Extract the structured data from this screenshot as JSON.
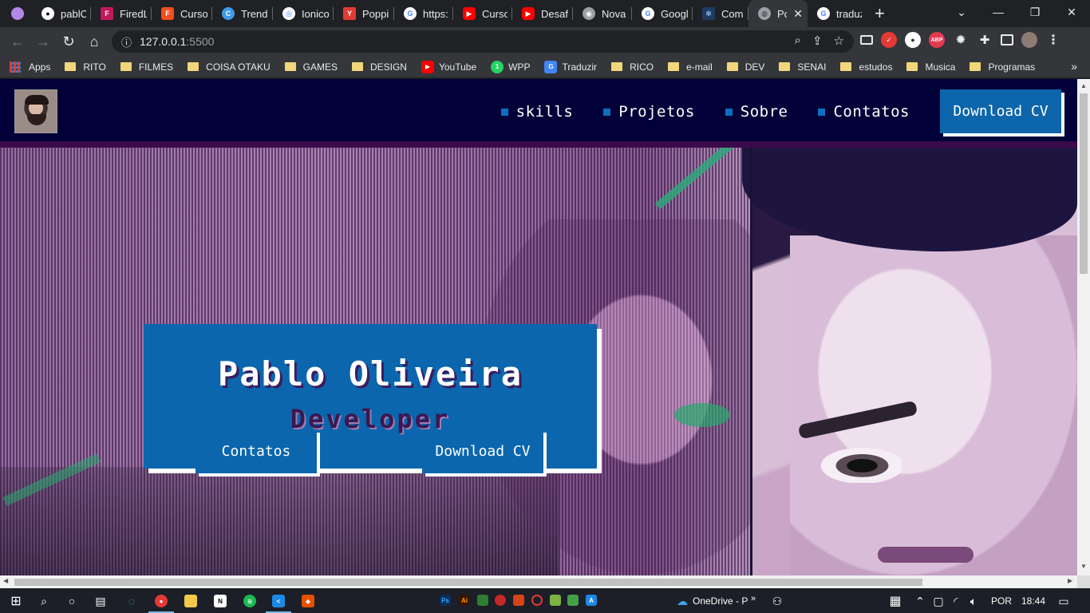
{
  "browser": {
    "tabs": [
      {
        "title": "",
        "icon": "purple-dot-icon",
        "color": "#b388e8"
      },
      {
        "title": "pablOl",
        "icon": "github-icon",
        "color": "#ffffff"
      },
      {
        "title": "FiredLa",
        "icon": "firedlab-icon",
        "color": "#c2185b"
      },
      {
        "title": "Curso_",
        "icon": "figma-icon",
        "color": "#f24e1e"
      },
      {
        "title": "Trendi",
        "icon": "trending-icon",
        "color": "#3d9be9"
      },
      {
        "title": "Ionicor",
        "icon": "ionicons-icon",
        "color": "#3880ff"
      },
      {
        "title": "Poppin",
        "icon": "poppins-icon",
        "color": "#e53935"
      },
      {
        "title": "https:/",
        "icon": "google-icon",
        "color": "#4285f4"
      },
      {
        "title": "Curso",
        "icon": "youtube-icon",
        "color": "#ff0000"
      },
      {
        "title": "Desafi",
        "icon": "youtube-icon",
        "color": "#ff0000"
      },
      {
        "title": "Nova g",
        "icon": "chrome-icon",
        "color": "#9aa0a6"
      },
      {
        "title": "Googl",
        "icon": "google-icon",
        "color": "#4285f4"
      },
      {
        "title": "Como",
        "icon": "snowflake-icon",
        "color": "#9fd3ff"
      },
      {
        "title": "Poi",
        "icon": "globe-icon",
        "color": "#9aa0a6"
      },
      {
        "title": "traduz",
        "icon": "google-icon",
        "color": "#4285f4"
      }
    ],
    "new_tab": "+",
    "url_host": "127.0.0.1",
    "url_port": ":5500",
    "bookmarks": [
      {
        "label": "Apps",
        "type": "apps"
      },
      {
        "label": "RITO",
        "type": "folder"
      },
      {
        "label": "FILMES",
        "type": "folder"
      },
      {
        "label": "COISA OTAKU",
        "type": "folder"
      },
      {
        "label": "GAMES",
        "type": "folder"
      },
      {
        "label": "DESIGN",
        "type": "folder"
      },
      {
        "label": "YouTube",
        "type": "youtube"
      },
      {
        "label": "WPP",
        "type": "whatsapp"
      },
      {
        "label": "Traduzir",
        "type": "translate"
      },
      {
        "label": "RICO",
        "type": "folder"
      },
      {
        "label": "e-mail",
        "type": "folder"
      },
      {
        "label": "DEV",
        "type": "folder"
      },
      {
        "label": "SENAI",
        "type": "folder"
      },
      {
        "label": "estudos",
        "type": "folder"
      },
      {
        "label": "Musica",
        "type": "folder"
      },
      {
        "label": "Programas",
        "type": "folder"
      }
    ]
  },
  "site": {
    "nav": [
      {
        "label": "skills"
      },
      {
        "label": "Projetos"
      },
      {
        "label": "Sobre"
      },
      {
        "label": "Contatos"
      }
    ],
    "header_cv": "Download CV",
    "hero": {
      "name": "Pablo Oliveira",
      "role": "Developer",
      "contact_button": "Contatos",
      "cv_button": "Download CV"
    },
    "colors": {
      "primary": "#0b66ad",
      "header_bg": "#010038",
      "accent_bar": "#3b0a4a"
    }
  },
  "taskbar": {
    "onedrive": "OneDrive - P",
    "lang": "POR",
    "time": "18:44"
  }
}
